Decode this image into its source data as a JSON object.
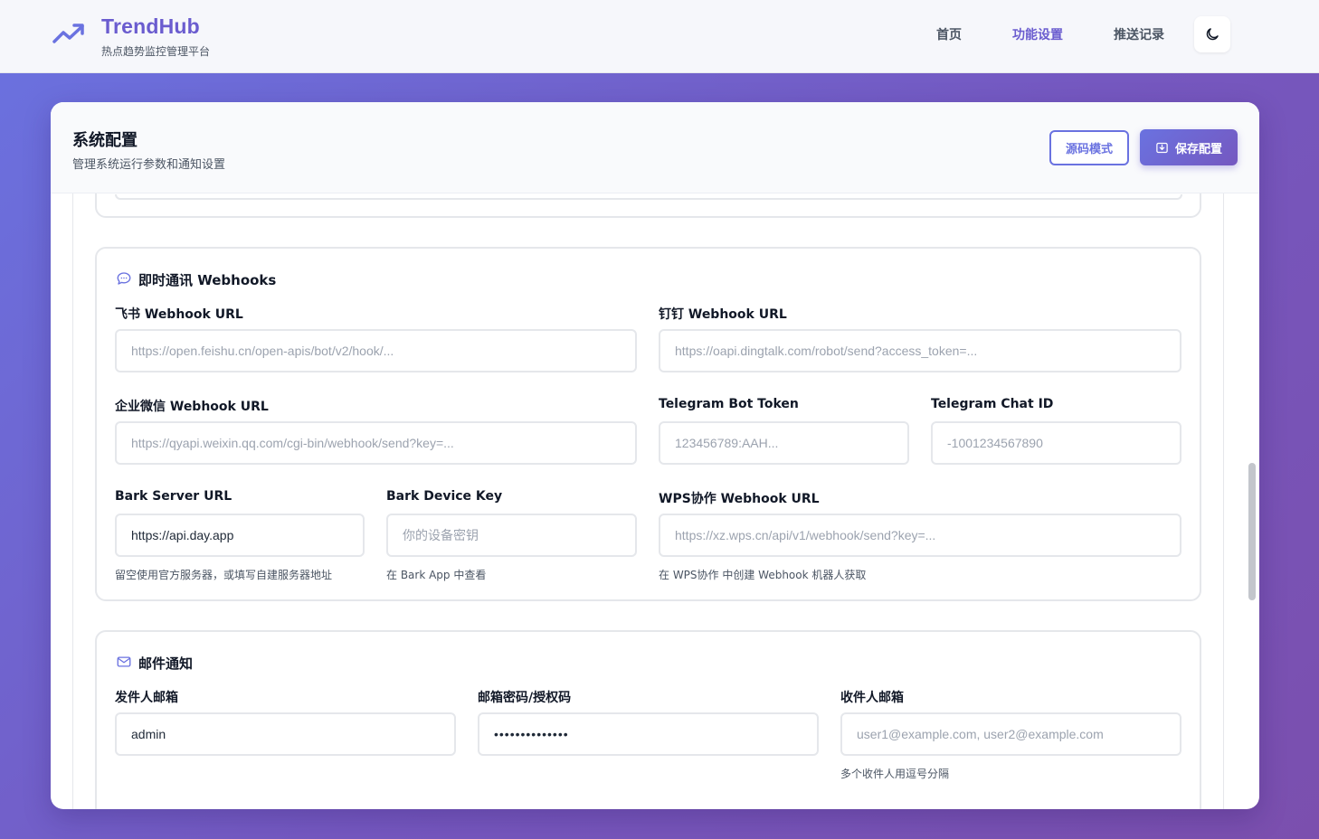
{
  "brand": {
    "title": "TrendHub",
    "subtitle": "热点趋势监控管理平台"
  },
  "nav": {
    "home": "首页",
    "settings": "功能设置",
    "history": "推送记录",
    "active": "功能设置"
  },
  "icons": {
    "logo": "trending-up-icon",
    "theme": "moon-icon",
    "save": "download-icon",
    "chat": "chat-bubble-icon",
    "mail": "mail-icon"
  },
  "colors": {
    "accent": "#6a5ccf",
    "gradient_start": "#6a72e0",
    "gradient_end": "#7b4fae"
  },
  "header": {
    "title": "系统配置",
    "subtitle": "管理系统运行参数和通知设置",
    "source_button": "源码模式",
    "save_button": "保存配置"
  },
  "webhooks": {
    "title": "即时通讯 Webhooks",
    "feishu": {
      "label": "飞书 Webhook URL",
      "value": "",
      "placeholder": "https://open.feishu.cn/open-apis/bot/v2/hook/..."
    },
    "dingtalk": {
      "label": "钉钉 Webhook URL",
      "value": "",
      "placeholder": "https://oapi.dingtalk.com/robot/send?access_token=..."
    },
    "wework": {
      "label": "企业微信 Webhook URL",
      "value": "",
      "placeholder": "https://qyapi.weixin.qq.com/cgi-bin/webhook/send?key=..."
    },
    "tg_token": {
      "label": "Telegram Bot Token",
      "value": "",
      "placeholder": "123456789:AAH..."
    },
    "tg_chat": {
      "label": "Telegram Chat ID",
      "value": "",
      "placeholder": "-1001234567890"
    },
    "bark_server": {
      "label": "Bark Server URL",
      "value": "https://api.day.app",
      "placeholder": "",
      "hint": "留空使用官方服务器，或填写自建服务器地址"
    },
    "bark_key": {
      "label": "Bark Device Key",
      "value": "",
      "placeholder": "你的设备密钥",
      "hint": "在 Bark App 中查看"
    },
    "wps": {
      "label": "WPS协作 Webhook URL",
      "value": "",
      "placeholder": "https://xz.wps.cn/api/v1/webhook/send?key=...",
      "hint": "在 WPS协作 中创建 Webhook 机器人获取"
    }
  },
  "email": {
    "title": "邮件通知",
    "sender": {
      "label": "发件人邮箱",
      "value": "admin",
      "placeholder": ""
    },
    "password": {
      "label": "邮箱密码/授权码",
      "value": "••••••••••••••"
    },
    "receivers": {
      "label": "收件人邮箱",
      "value": "",
      "placeholder": "user1@example.com, user2@example.com",
      "hint": "多个收件人用逗号分隔"
    }
  }
}
